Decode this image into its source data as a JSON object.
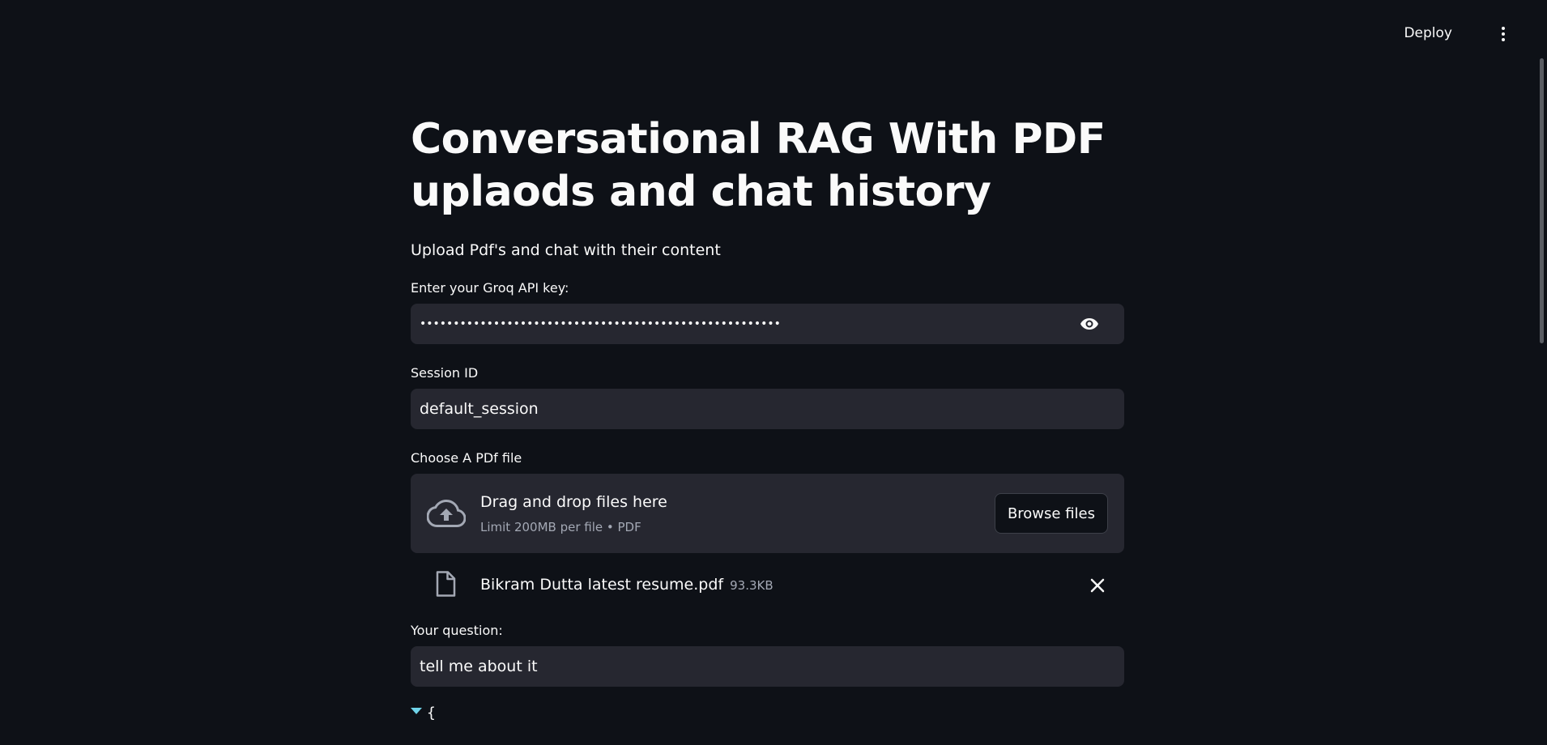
{
  "header": {
    "deploy_label": "Deploy"
  },
  "main": {
    "title": "Conversational RAG With PDF uplaods and chat history",
    "subtitle": "Upload Pdf's and chat with their content",
    "api_key": {
      "label": "Enter your Groq API key:",
      "masked_value": "••••••••••••••••••••••••••••••••••••••••••••••••••••••"
    },
    "session": {
      "label": "Session ID",
      "value": "default_session"
    },
    "uploader": {
      "label": "Choose A PDf file",
      "drop_title": "Drag and drop files here",
      "limit_text": "Limit 200MB per file • PDF",
      "browse_label": "Browse files"
    },
    "uploaded_file": {
      "name": "Bikram Dutta latest resume.pdf",
      "size": "93.3KB"
    },
    "question": {
      "label": "Your question:",
      "value": "tell me about it"
    },
    "json_viewer": {
      "open_brace": "{"
    }
  },
  "colors": {
    "background": "#0e1117",
    "input_bg": "#262730",
    "text": "#fafafa",
    "muted": "#a3a8b4",
    "json_caret": "#6fd3e9"
  },
  "icons": {
    "menu": "vertical-dots-icon",
    "password_toggle": "eye-icon",
    "upload": "cloud-upload-icon",
    "file": "file-icon",
    "remove": "close-icon"
  }
}
